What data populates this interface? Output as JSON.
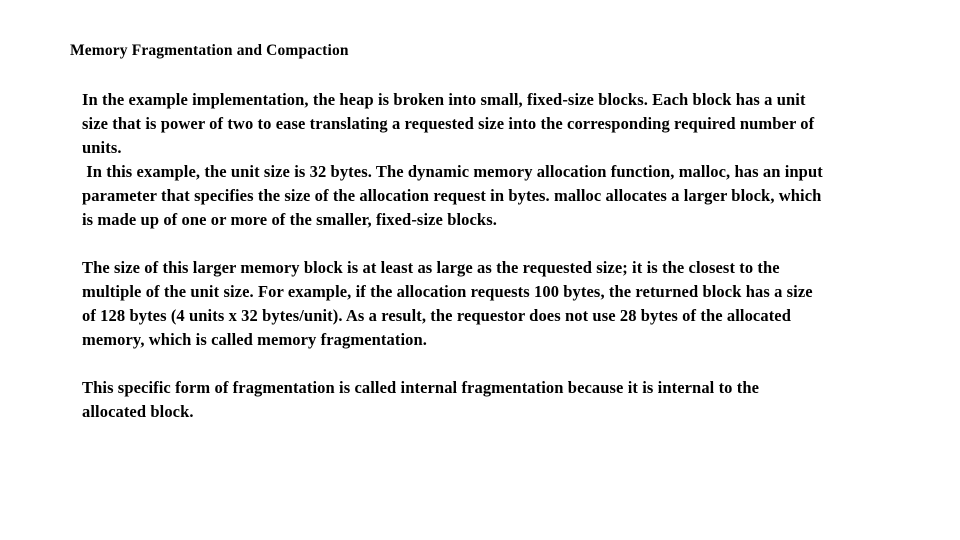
{
  "document": {
    "title": "Memory Fragmentation and Compaction",
    "background_color": "#ffffff",
    "text_color": "#000000",
    "paragraphs": [
      {
        "id": "paragraph-1",
        "lines": [
          "In the example implementation, the heap is broken into small, fixed-size blocks. Each block has a unit",
          "size that is power of two to ease translating a requested size into the corresponding required number of",
          "units.",
          " In this example, the unit size is 32 bytes. The dynamic memory allocation function, malloc, has an input",
          "parameter that specifies the size of the allocation request in bytes. malloc allocates a larger block, which",
          "is made up of one or more of the smaller, fixed-size blocks."
        ]
      },
      {
        "id": "paragraph-2",
        "lines": [
          "The size of this larger memory block is at least as large as the requested size; it is the closest to the",
          "multiple of the unit size. For example, if the allocation requests 100 bytes, the returned block has a size",
          "of 128 bytes (4 units x 32 bytes/unit). As a result, the requestor does not use 28 bytes of the allocated",
          "memory, which is called memory fragmentation."
        ]
      },
      {
        "id": "paragraph-3",
        "lines": [
          "This specific form of fragmentation is called internal fragmentation because it is internal to the",
          "allocated block."
        ]
      }
    ]
  }
}
